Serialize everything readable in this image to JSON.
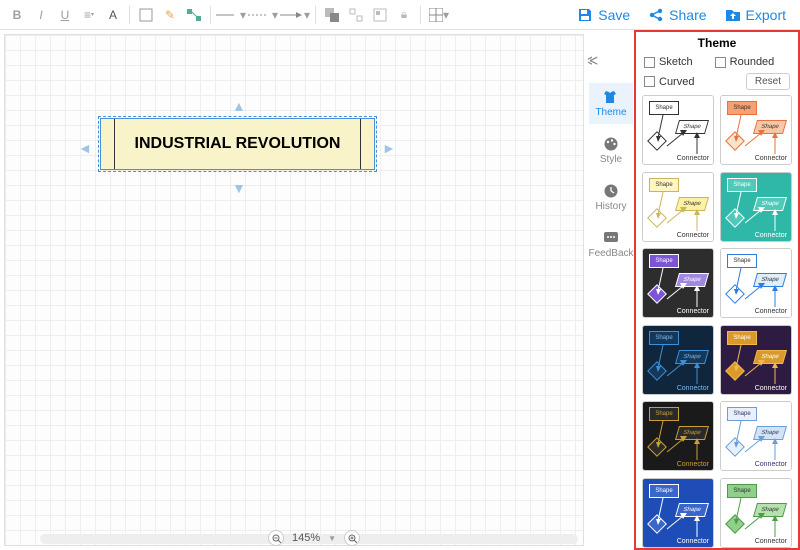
{
  "toolbar": {
    "actions": {
      "save": "Save",
      "share": "Share",
      "export": "Export"
    }
  },
  "canvas": {
    "main_shape_text": "INDUSTRIAL REVOLUTION",
    "zoom": "145%"
  },
  "side_tabs": {
    "theme": "Theme",
    "style": "Style",
    "history": "History",
    "feedback": "FeedBack"
  },
  "panel": {
    "title": "Theme",
    "sketch": "Sketch",
    "rounded": "Rounded",
    "curved": "Curved",
    "reset": "Reset",
    "swatch_shape_label": "Shape",
    "swatch_connector_label": "Connector",
    "themes": [
      {
        "bg": "#ffffff",
        "c1": "#ffffff",
        "b1": "#333333",
        "c2": "#ffffff",
        "b2": "#333333",
        "c3": "#ffffff",
        "b3": "#333333",
        "txt": "#333"
      },
      {
        "bg": "#ffffff",
        "c1": "#f7a071",
        "b1": "#e8713f",
        "c2": "#f8c8a6",
        "b2": "#e8713f",
        "c3": "#fde2cb",
        "b3": "#e8713f",
        "txt": "#333"
      },
      {
        "bg": "#ffffff",
        "c1": "#fff6c2",
        "b1": "#c9b65a",
        "c2": "#fff0a3",
        "b2": "#c9b65a",
        "c3": "#ffffff",
        "b3": "#c9b65a",
        "txt": "#333"
      },
      {
        "bg": "#2fb8a7",
        "c1": "#4fcab9",
        "b1": "#ffffff",
        "c2": "#4fcab9",
        "b2": "#ffffff",
        "c3": "#4fcab9",
        "b3": "#ffffff",
        "txt": "#fff"
      },
      {
        "bg": "#2d2d2d",
        "c1": "#7b55d6",
        "b1": "#ffffff",
        "c2": "#a087e0",
        "b2": "#ffffff",
        "c3": "#7b55d6",
        "b3": "#ffffff",
        "txt": "#fff"
      },
      {
        "bg": "#ffffff",
        "c1": "#ffffff",
        "b1": "#2b7de1",
        "c2": "#e0edfb",
        "b2": "#2b7de1",
        "c3": "#ffffff",
        "b3": "#2b7de1",
        "txt": "#333"
      },
      {
        "bg": "#10263d",
        "c1": "#143859",
        "b1": "#3f8fd4",
        "c2": "#143859",
        "b2": "#3f8fd4",
        "c3": "#143859",
        "b3": "#3f8fd4",
        "txt": "#7fb8e8"
      },
      {
        "bg": "#2d1b42",
        "c1": "#d99a2b",
        "b1": "#f0b84d",
        "c2": "#d99a2b",
        "b2": "#f0b84d",
        "c3": "#d99a2b",
        "b3": "#f0b84d",
        "txt": "#fff"
      },
      {
        "bg": "#1a1a1a",
        "c1": "#2a2a2a",
        "b1": "#c9a037",
        "c2": "#2a2a2a",
        "b2": "#c9a037",
        "c3": "#2a2a2a",
        "b3": "#c9a037",
        "txt": "#c9a037"
      },
      {
        "bg": "#ffffff",
        "c1": "#e8f0fb",
        "b1": "#6a9edb",
        "c2": "#d3e3f6",
        "b2": "#6a9edb",
        "c3": "#e8f0fb",
        "b3": "#6a9edb",
        "txt": "#336"
      },
      {
        "bg": "#1e4db7",
        "c1": "#3a66c9",
        "b1": "#ffffff",
        "c2": "#3a66c9",
        "b2": "#ffffff",
        "c3": "#3a66c9",
        "b3": "#ffffff",
        "txt": "#fff"
      },
      {
        "bg": "#ffffff",
        "c1": "#8fd18a",
        "b1": "#4f9b49",
        "c2": "#b5e2af",
        "b2": "#4f9b49",
        "c3": "#8fd18a",
        "b3": "#4f9b49",
        "txt": "#333"
      }
    ]
  }
}
